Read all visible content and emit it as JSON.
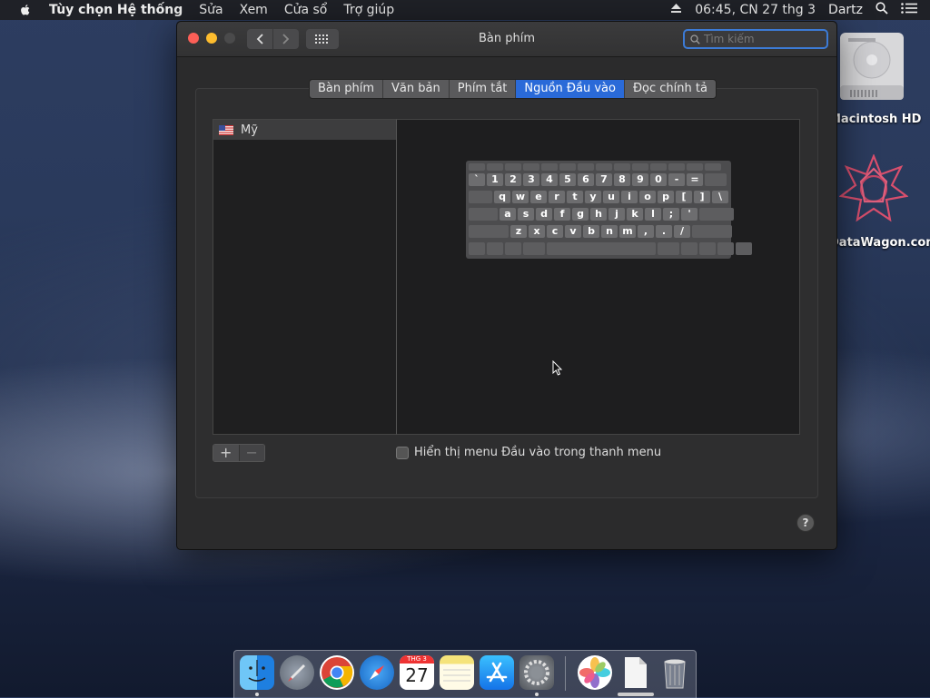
{
  "menubar": {
    "app": "Tùy chọn Hệ thống",
    "items": [
      "Sửa",
      "Xem",
      "Cửa sổ",
      "Trợ giúp"
    ],
    "clock": "06:45, CN 27 thg 3",
    "user": "Dartz"
  },
  "window": {
    "title": "Bàn phím",
    "search_placeholder": "Tìm kiếm",
    "tabs": [
      "Bàn phím",
      "Văn bản",
      "Phím tắt",
      "Nguồn Đầu vào",
      "Đọc chính tả"
    ],
    "active_tab": "Nguồn Đầu vào",
    "input_sources": [
      {
        "label": "Mỹ"
      }
    ],
    "add_label": "+",
    "remove_label": "−",
    "checkbox_label": "Hiển thị menu Đầu vào trong thanh menu",
    "help_label": "?"
  },
  "keyboard": {
    "row1": [
      "`",
      "1",
      "2",
      "3",
      "4",
      "5",
      "6",
      "7",
      "8",
      "9",
      "0",
      "-",
      "="
    ],
    "row2": [
      "q",
      "w",
      "e",
      "r",
      "t",
      "y",
      "u",
      "i",
      "o",
      "p",
      "[",
      "]",
      "\\"
    ],
    "row3": [
      "a",
      "s",
      "d",
      "f",
      "g",
      "h",
      "j",
      "k",
      "l",
      ";",
      "'"
    ],
    "row4": [
      "z",
      "x",
      "c",
      "v",
      "b",
      "n",
      "m",
      ",",
      ".",
      "/"
    ]
  },
  "desktop": {
    "drive_label": "Macintosh HD",
    "app_label": "DataWagon.com"
  },
  "dock": {
    "calendar_month": "THG 3",
    "calendar_day": "27"
  },
  "colors": {
    "accent": "#2a6ad8",
    "close": "#fc5f57",
    "minimize": "#fdbc2e"
  }
}
